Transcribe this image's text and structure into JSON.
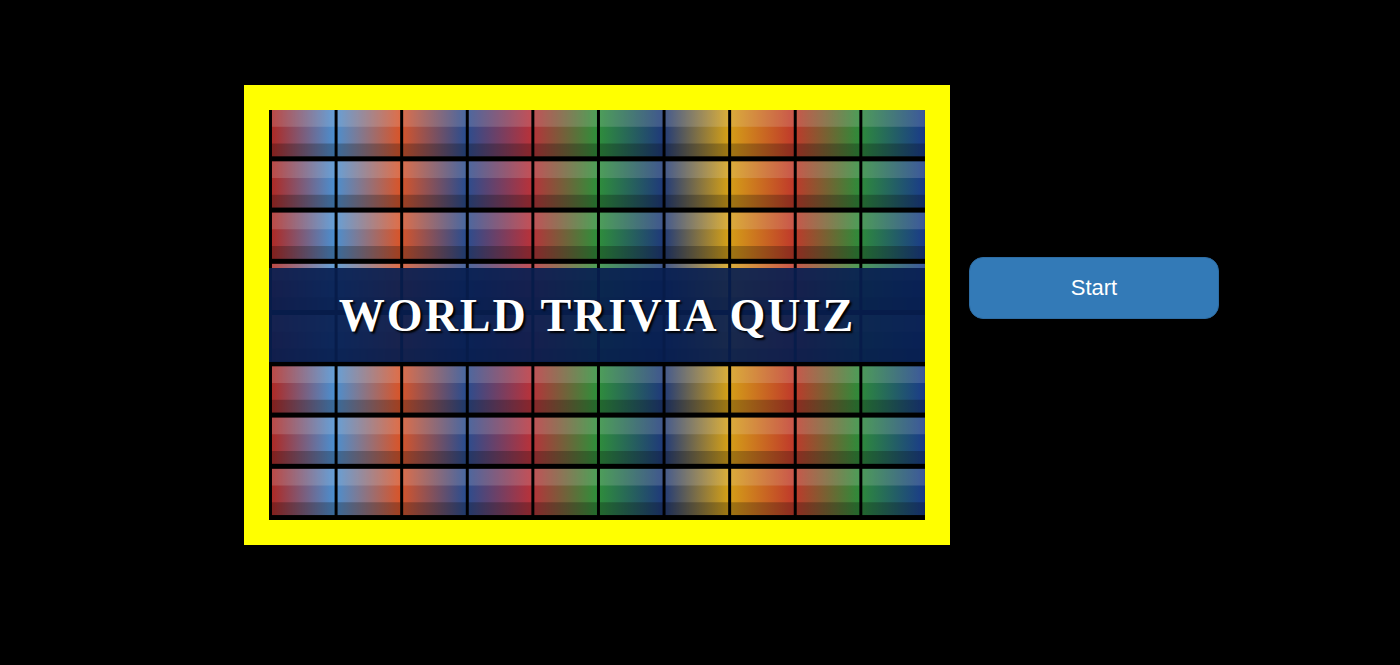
{
  "picture": {
    "title": "WORLD TRIVIA QUIZ"
  },
  "buttons": [
    {
      "label": "Start"
    }
  ]
}
